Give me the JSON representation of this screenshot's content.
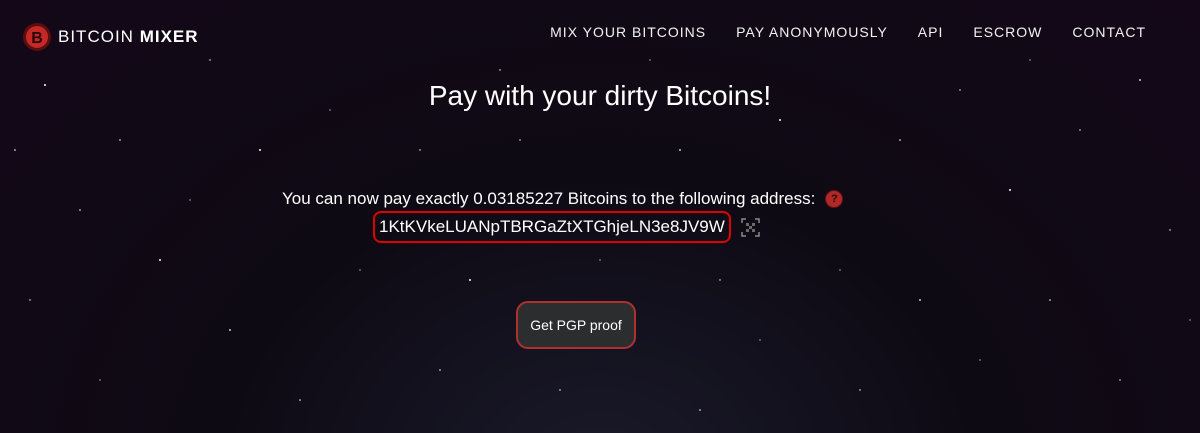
{
  "brand": {
    "name_regular": "BITCOIN",
    "name_bold": "MIXER",
    "accent_color": "#c62828"
  },
  "nav": {
    "items": [
      {
        "label": "MIX YOUR BITCOINS"
      },
      {
        "label": "PAY ANONYMOUSLY"
      },
      {
        "label": "API"
      },
      {
        "label": "ESCROW"
      },
      {
        "label": "CONTACT"
      }
    ]
  },
  "main": {
    "title": "Pay with your dirty Bitcoins!",
    "instruction": "You can now pay exactly 0.03185227 Bitcoins to the following address:",
    "help_icon": "?",
    "address": "1KtKVkeLUANpTBRGaZtXTGhjeLN3e8JV9W",
    "qr_icon": "qr-code-icon",
    "pgp_button_label": "Get PGP proof",
    "address_highlight_color": "#e00000"
  }
}
